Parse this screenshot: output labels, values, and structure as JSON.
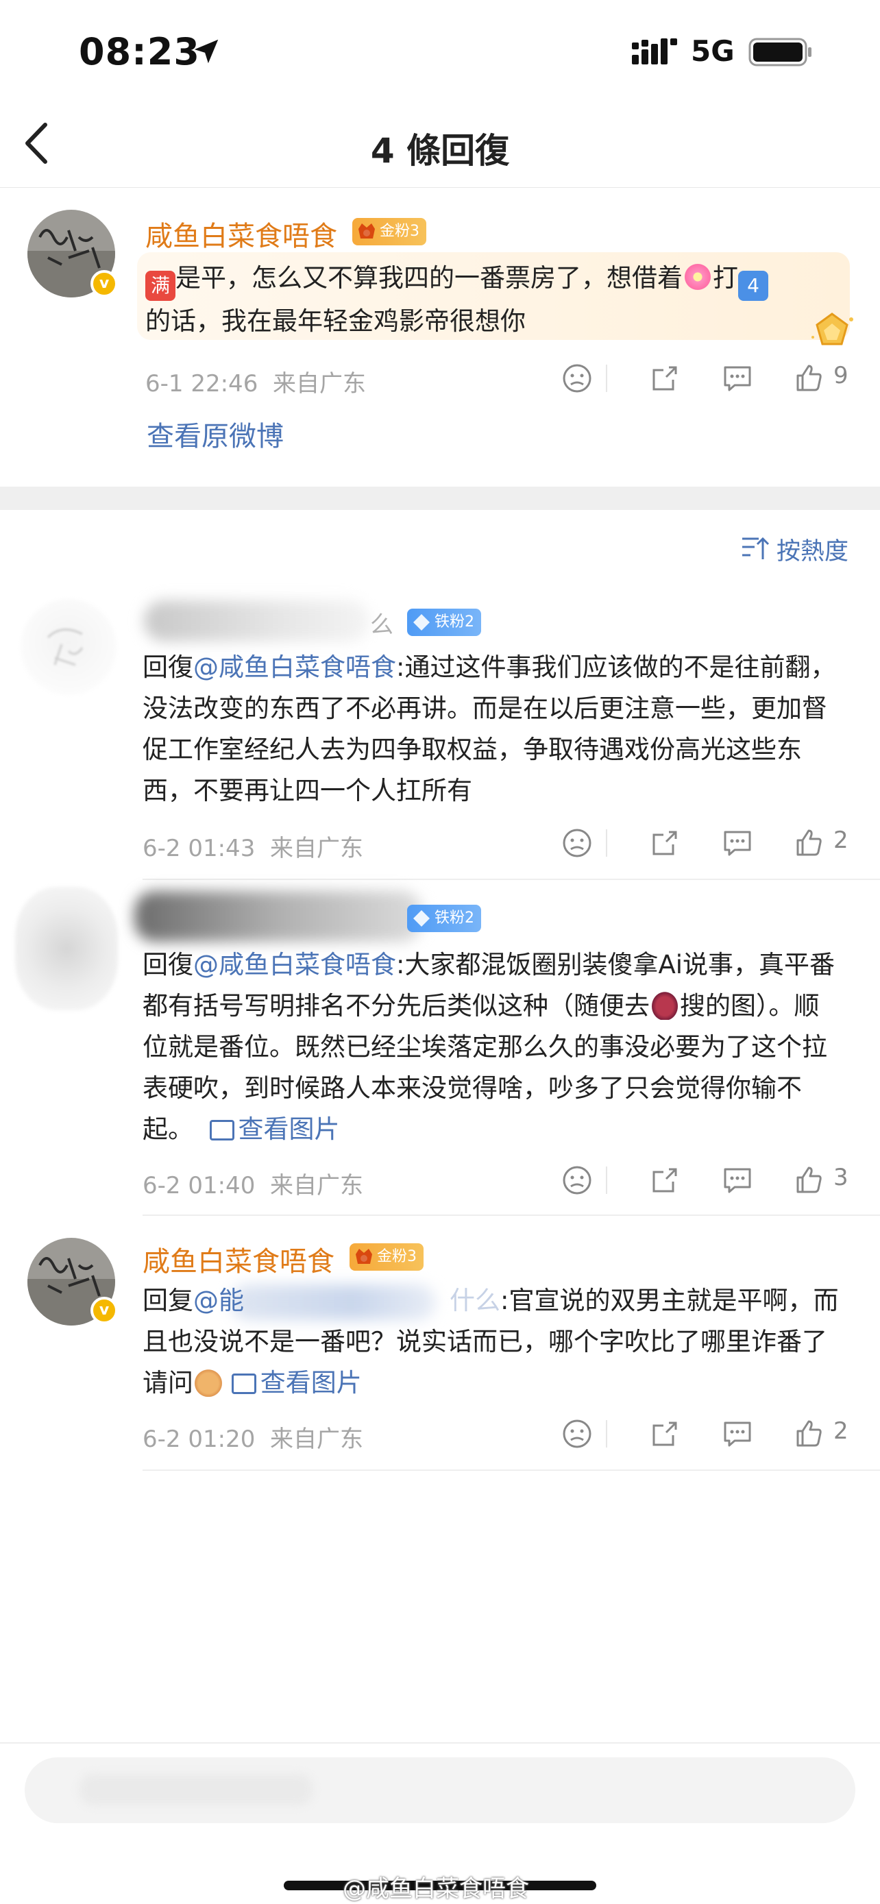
{
  "status_bar": {
    "time": "08:23",
    "network": "5G"
  },
  "nav": {
    "title": "4 條回復"
  },
  "original": {
    "username": "咸鱼白菜食唔食",
    "fan_badge": "金粉3",
    "text_emoji1": "满",
    "text_part1": "是平，怎么又不算我四的一番票房了，想借着",
    "text_part2": "打",
    "text_emoji3": "4",
    "text_part3": "的话，我在最年轻金鸡影帝很想你",
    "date": "6-1 22:46",
    "source": "来自广东",
    "likes": "9",
    "view_original": "查看原微博"
  },
  "sort": {
    "label": "按熱度"
  },
  "replies": [
    {
      "username_visible": "么",
      "fan_badge": "铁粉2",
      "reply_prefix": "回復",
      "mention": "@咸鱼白菜食唔食",
      "text": ":通过这件事我们应该做的不是往前翻，没法改变的东西了不必再讲。而是在以后更注意一些，更加督促工作室经纪人去为四争取权益，争取待遇戏份高光这些东西，不要再让四一个人扛所有",
      "date": "6-2 01:43",
      "source": "来自广东",
      "likes": "2"
    },
    {
      "fan_badge": "铁粉2",
      "reply_prefix": "回復",
      "mention": "@咸鱼白菜食唔食",
      "text_a": ":大家都混饭圈别装傻拿Ai说事，真平番都有括号写明排名不分先后类似这种（随便去",
      "text_b": "搜的图）。顺位就是番位。既然已经尘埃落定那么久的事没必要为了这个拉表硬吹，到时候路人本来没觉得啥，吵多了只会觉得你输不起。",
      "view_image": "查看图片",
      "date": "6-2 01:40",
      "source": "来自广东",
      "likes": "3"
    },
    {
      "username": "咸鱼白菜食唔食",
      "fan_badge": "金粉3",
      "reply_prefix": "回复",
      "mention_start": "@能",
      "mention_end": "什么",
      "text": ":官宣说的双男主就是平啊，而且也没说不是一番吧？说实话而已，哪个字吹比了哪里诈番了请问",
      "view_image": "查看图片",
      "date": "6-2 01:20",
      "source": "来自广东",
      "likes": "2"
    }
  ],
  "watermark": "@咸鱼白菜食唔食",
  "colors": {
    "username": "#e07b18",
    "link": "#4b74b6",
    "meta": "#a5a5a5",
    "gold_badge": "#f6a93a",
    "iron_badge": "#4f9bf5"
  },
  "icons": [
    "location-arrow-icon",
    "signal-icon",
    "battery-icon",
    "back-chevron-icon",
    "dislike-icon",
    "share-icon",
    "comment-icon",
    "like-icon",
    "sort-icon",
    "image-icon",
    "verified-icon"
  ]
}
